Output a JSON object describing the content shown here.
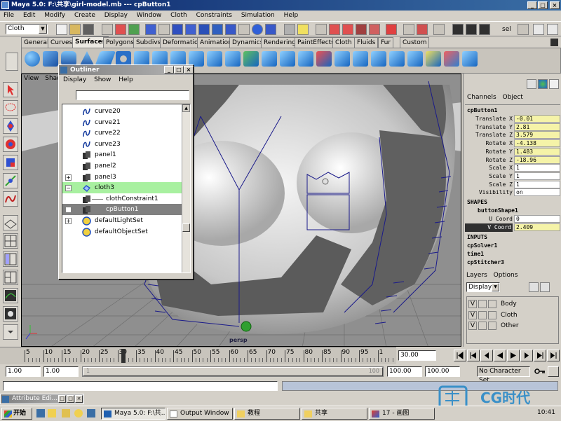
{
  "titlebar": {
    "title": "Maya 5.0: F:\\共享\\girl-model.mb  ---  cpButton1",
    "minimize": "_",
    "maximize": "□",
    "close": "×"
  },
  "menubar": {
    "items": [
      "File",
      "Edit",
      "Modify",
      "Create",
      "Display",
      "Window",
      "Cloth",
      "Constraints",
      "Simulation",
      "Help"
    ]
  },
  "statusline": {
    "menu_set": "Cloth",
    "sel_label": "sel"
  },
  "shelf_tabs": [
    "General",
    "Curves",
    "Surfaces",
    "Polygons",
    "Subdivs",
    "Deformation",
    "Animation",
    "Dynamics",
    "Rendering",
    "PaintEffects",
    "Cloth",
    "Fluids",
    "Fur",
    "Custom"
  ],
  "shelf_active": "Surfaces",
  "viewport": {
    "menu": [
      "View",
      "Shading"
    ],
    "camera_label": "persp"
  },
  "outliner": {
    "title": "Outliner",
    "menu": [
      "Display",
      "Show",
      "Help"
    ],
    "filter": "",
    "items": [
      {
        "name": "curve20",
        "icon": "curve-icon",
        "indent": 0,
        "expander": ""
      },
      {
        "name": "curve21",
        "icon": "curve-icon",
        "indent": 0,
        "expander": ""
      },
      {
        "name": "curve22",
        "icon": "curve-icon",
        "indent": 0,
        "expander": ""
      },
      {
        "name": "curve23",
        "icon": "curve-icon",
        "indent": 0,
        "expander": ""
      },
      {
        "name": "panel1",
        "icon": "panel-icon",
        "indent": 0,
        "expander": ""
      },
      {
        "name": "panel2",
        "icon": "panel-icon",
        "indent": 0,
        "expander": ""
      },
      {
        "name": "panel3",
        "icon": "panel-icon",
        "indent": 0,
        "expander": "+"
      },
      {
        "name": "cloth3",
        "icon": "cloth-icon",
        "indent": 0,
        "expander": "−",
        "state": "selected-green"
      },
      {
        "name": "clothConstraint1",
        "icon": "constraint-icon",
        "indent": 1,
        "expander": ""
      },
      {
        "name": "cpButton1",
        "icon": "constraint-icon",
        "indent": 1,
        "expander": "+",
        "state": "selected-gray"
      },
      {
        "name": "defaultLightSet",
        "icon": "set-icon",
        "indent": 0,
        "expander": "+"
      },
      {
        "name": "defaultObjectSet",
        "icon": "set-icon",
        "indent": 0,
        "expander": ""
      }
    ]
  },
  "channel_box": {
    "tabs": [
      "Channels",
      "Object"
    ],
    "node": "cpButton1",
    "channels": [
      {
        "label": "Translate X",
        "value": "-0.01",
        "highlight": true
      },
      {
        "label": "Translate Y",
        "value": "2.81",
        "highlight": true
      },
      {
        "label": "Translate Z",
        "value": "3.579",
        "highlight": true
      },
      {
        "label": "Rotate X",
        "value": "-4.138",
        "highlight": true
      },
      {
        "label": "Rotate Y",
        "value": "1.483",
        "highlight": true
      },
      {
        "label": "Rotate Z",
        "value": "-18.96",
        "highlight": true
      },
      {
        "label": "Scale X",
        "value": "1",
        "highlight": false
      },
      {
        "label": "Scale Y",
        "value": "1",
        "highlight": false
      },
      {
        "label": "Scale Z",
        "value": "1",
        "highlight": false
      },
      {
        "label": "Visibility",
        "value": "on",
        "highlight": false
      }
    ],
    "shapes_header": "SHAPES",
    "shape_node": "buttonShape1",
    "shape_channels": [
      {
        "label": "U Coord",
        "value": "0",
        "selected": false
      },
      {
        "label": "V Coord",
        "value": "2.409",
        "selected": true
      }
    ],
    "inputs_header": "INPUTS",
    "inputs": [
      "cpSolver1",
      "time1",
      "cpStitcher3"
    ]
  },
  "layers": {
    "tabs": [
      "Layers",
      "Options"
    ],
    "display_dropdown": "Display",
    "items": [
      {
        "vis": "V",
        "name": "Body"
      },
      {
        "vis": "V",
        "name": "Cloth"
      },
      {
        "vis": "V",
        "name": "Other"
      }
    ]
  },
  "timeline": {
    "ticks": [
      "5",
      "10",
      "15",
      "20",
      "25",
      "30",
      "35",
      "40",
      "45",
      "50",
      "55",
      "60",
      "65",
      "70",
      "75",
      "80",
      "85",
      "90",
      "95",
      "1"
    ],
    "current_frame": "30.00"
  },
  "range": {
    "start": "1.00",
    "playback_start": "1.00",
    "slider_start": "1",
    "slider_end": "100",
    "playback_end": "100.00",
    "end": "100.00",
    "character_set": "No Character Set"
  },
  "taskbar": {
    "start_label": "开始",
    "tasks": [
      "Attribute Edi...",
      "Maya 5.0: F:\\共...",
      "Output Window",
      "教程",
      "共享",
      "17 - 画图"
    ],
    "clock": "10:41"
  },
  "watermark": {
    "text": "CG时代"
  },
  "colors": {
    "title_blue": "#0a246a",
    "outliner_selected": "#a8f0a0",
    "channel_highlight": "#f5f3a8"
  }
}
